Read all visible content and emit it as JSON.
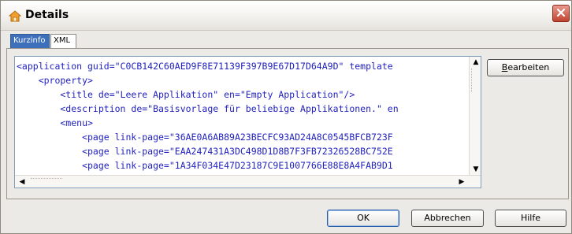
{
  "window": {
    "title": "Details",
    "icon": "house-folder-icon",
    "close_icon": "close-icon"
  },
  "tabs": [
    {
      "label": "Kurzinfo",
      "selected": false
    },
    {
      "label": "XML",
      "selected": true
    }
  ],
  "editor": {
    "lines": [
      "<application guid=\"C0CB142C60AED9F8E71139F397B9E67D17D64A9D\" template",
      "    <property>",
      "        <title de=\"Leere Applikation\" en=\"Empty Application\"/>",
      "        <description de=\"Basisvorlage für beliebige Applikationen.\" en",
      "        <menu>",
      "            <page link-page=\"36AE0A6AB89A23BECFC93AD24A8C0545BFCB723F",
      "            <page link-page=\"EAA247431A3DC498D1D8B7F3FB72326528BC752E",
      "            <page link-page=\"1A34F034E47D23187C9E1007766E88E8A4FAB9D1"
    ]
  },
  "buttons": {
    "edit": "Bearbeiten",
    "ok": "OK",
    "cancel": "Abbrechen",
    "help": "Hilfe"
  },
  "colors": {
    "accent": "#3d6fbb",
    "close": "#c0442f",
    "tag": "#1f1fbf"
  }
}
